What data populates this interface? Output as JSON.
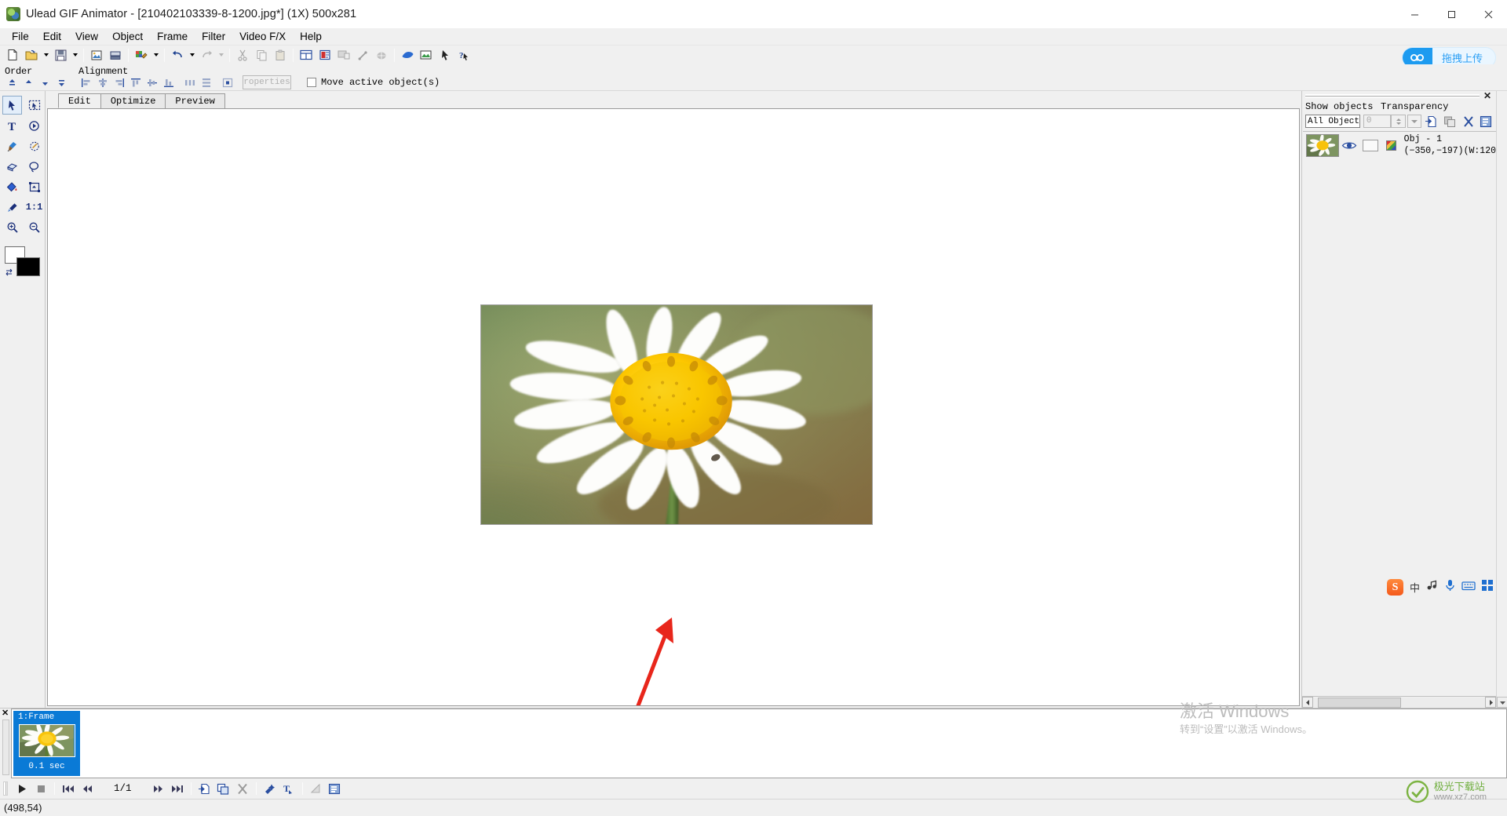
{
  "window": {
    "title": "Ulead GIF Animator - [210402103339-8-1200.jpg*] (1X) 500x281",
    "app_icon": "app-icon",
    "minimize": "—",
    "maximize": "☐",
    "close": "✕"
  },
  "menu": {
    "items": [
      {
        "label": "File"
      },
      {
        "label": "Edit"
      },
      {
        "label": "View"
      },
      {
        "label": "Object"
      },
      {
        "label": "Frame"
      },
      {
        "label": "Filter"
      },
      {
        "label": "Video F/X"
      },
      {
        "label": "Help"
      }
    ]
  },
  "toolbar": {
    "buttons": [
      {
        "name": "new-icon",
        "glyph": "new"
      },
      {
        "name": "open-icon",
        "glyph": "open",
        "has_dropdown": true
      },
      {
        "name": "save-icon",
        "glyph": "save",
        "has_dropdown": true
      },
      {
        "name": "add-image-icon",
        "glyph": "addimage"
      },
      {
        "name": "add-banner-icon",
        "glyph": "banner"
      },
      {
        "name": "optimize-icon",
        "glyph": "palette",
        "has_dropdown": true
      },
      {
        "name": "undo-icon",
        "glyph": "undo",
        "has_dropdown": true
      },
      {
        "name": "redo-icon",
        "glyph": "redo",
        "has_dropdown": true,
        "disabled": true
      },
      {
        "name": "cut-icon",
        "glyph": "cut",
        "disabled": true
      },
      {
        "name": "copy-icon",
        "glyph": "copy",
        "disabled": true
      },
      {
        "name": "paste-icon",
        "glyph": "paste",
        "disabled": true
      },
      {
        "name": "frame-panel-icon",
        "glyph": "framepanel"
      },
      {
        "name": "object-manager-icon",
        "glyph": "objmanager"
      },
      {
        "name": "preview-icon",
        "glyph": "preview",
        "disabled": true
      },
      {
        "name": "wand-icon",
        "glyph": "wand",
        "disabled": true
      },
      {
        "name": "globe-icon",
        "glyph": "globe",
        "disabled": true
      },
      {
        "name": "browser-preview-icon",
        "glyph": "browser"
      },
      {
        "name": "image-effect-icon",
        "glyph": "imgfx"
      },
      {
        "name": "cursor-help-icon",
        "glyph": "arrowcursor"
      },
      {
        "name": "help-pointer-icon",
        "glyph": "whathis"
      }
    ],
    "upload_button": {
      "label": "拖拽上传",
      "icon": "cloud-upload-icon",
      "accent": "#1d9bf0"
    }
  },
  "align_bar": {
    "order_label": "Order",
    "alignment_label": "Alignment",
    "order_buttons": [
      {
        "name": "bring-to-front-icon"
      },
      {
        "name": "bring-forward-icon"
      },
      {
        "name": "send-backward-icon"
      },
      {
        "name": "send-to-back-icon"
      }
    ],
    "align_buttons": [
      {
        "name": "align-left-icon"
      },
      {
        "name": "align-center-horizontal-icon"
      },
      {
        "name": "align-right-icon"
      },
      {
        "name": "align-top-icon"
      },
      {
        "name": "align-middle-icon"
      },
      {
        "name": "align-bottom-icon"
      },
      {
        "name": "distribute-horizontal-icon"
      },
      {
        "name": "distribute-vertical-icon"
      },
      {
        "name": "center-both-icon"
      }
    ],
    "properties_button": "roperties",
    "move_active_checkbox": {
      "label": "Move active object(s)",
      "checked": false
    }
  },
  "toolbox": {
    "tools": [
      {
        "name": "pick-tool",
        "selected": true
      },
      {
        "name": "selection-tool",
        "selected": false
      },
      {
        "name": "text-tool",
        "selected": false
      },
      {
        "name": "rotate-tool",
        "selected": false
      },
      {
        "name": "paintbrush-tool",
        "selected": false
      },
      {
        "name": "magic-wand-tool",
        "selected": false
      },
      {
        "name": "eraser-tool",
        "selected": false
      },
      {
        "name": "lasso-tool",
        "selected": false
      },
      {
        "name": "paint-bucket-tool",
        "selected": false
      },
      {
        "name": "crop-tool",
        "selected": false
      },
      {
        "name": "eyedropper-tool",
        "selected": false
      },
      {
        "name": "actual-size-tool",
        "selected": false,
        "label": "1:1"
      },
      {
        "name": "zoom-in-tool",
        "selected": false
      },
      {
        "name": "zoom-out-tool",
        "selected": false
      }
    ],
    "foreground_color": "#ffffff",
    "background_color": "#000000"
  },
  "tabs": [
    {
      "label": "Edit",
      "active": true
    },
    {
      "label": "Optimize",
      "active": false
    },
    {
      "label": "Preview",
      "active": false
    }
  ],
  "canvas": {
    "artboard": {
      "width_label": "500",
      "height_label": "281"
    },
    "annotation_arrow": {
      "name": "red-arrow-annotation",
      "color": "#e8261b"
    }
  },
  "object_panel": {
    "show_objects_label": "Show objects",
    "transparency_label": "Transparency",
    "filter_value": "All Object:",
    "transparency_value": "0",
    "close_label": "✕",
    "toolbar_icons": [
      {
        "name": "add-object-icon"
      },
      {
        "name": "duplicate-object-icon"
      },
      {
        "name": "delete-object-icon"
      },
      {
        "name": "object-properties-icon"
      }
    ],
    "objects": [
      {
        "name": "Obj - 1",
        "position": "(−350,−197)(W:120",
        "visible": true
      }
    ]
  },
  "ime": {
    "logo": "S",
    "mode": "中",
    "items": [
      "pinyin-icon",
      "microphone-icon",
      "keyboard-icon",
      "apps-icon"
    ]
  },
  "frame_panel": {
    "close_label": "✕",
    "frames": [
      {
        "label": "1:Frame",
        "delay": "0.1 sec",
        "selected": true
      }
    ]
  },
  "transport": {
    "buttons": [
      {
        "name": "play-button"
      },
      {
        "name": "stop-button"
      },
      {
        "name": "first-frame-button"
      },
      {
        "name": "previous-frame-button"
      },
      {
        "name": "next-frame-button"
      },
      {
        "name": "last-frame-button"
      },
      {
        "name": "add-frame-button"
      },
      {
        "name": "duplicate-frame-button"
      },
      {
        "name": "delete-frame-button"
      },
      {
        "name": "frame-effect-button"
      },
      {
        "name": "text-effect-button"
      },
      {
        "name": "transition-button"
      },
      {
        "name": "frame-properties-button"
      }
    ],
    "counter": "1/1"
  },
  "statusbar": {
    "coordinates": "(498,54)"
  },
  "watermarks": {
    "activate_line1": "激活 Windows",
    "activate_line2": "转到“设置”以激活 Windows。",
    "site_name": "极光下载站",
    "site_url": "www.xz7.com"
  }
}
